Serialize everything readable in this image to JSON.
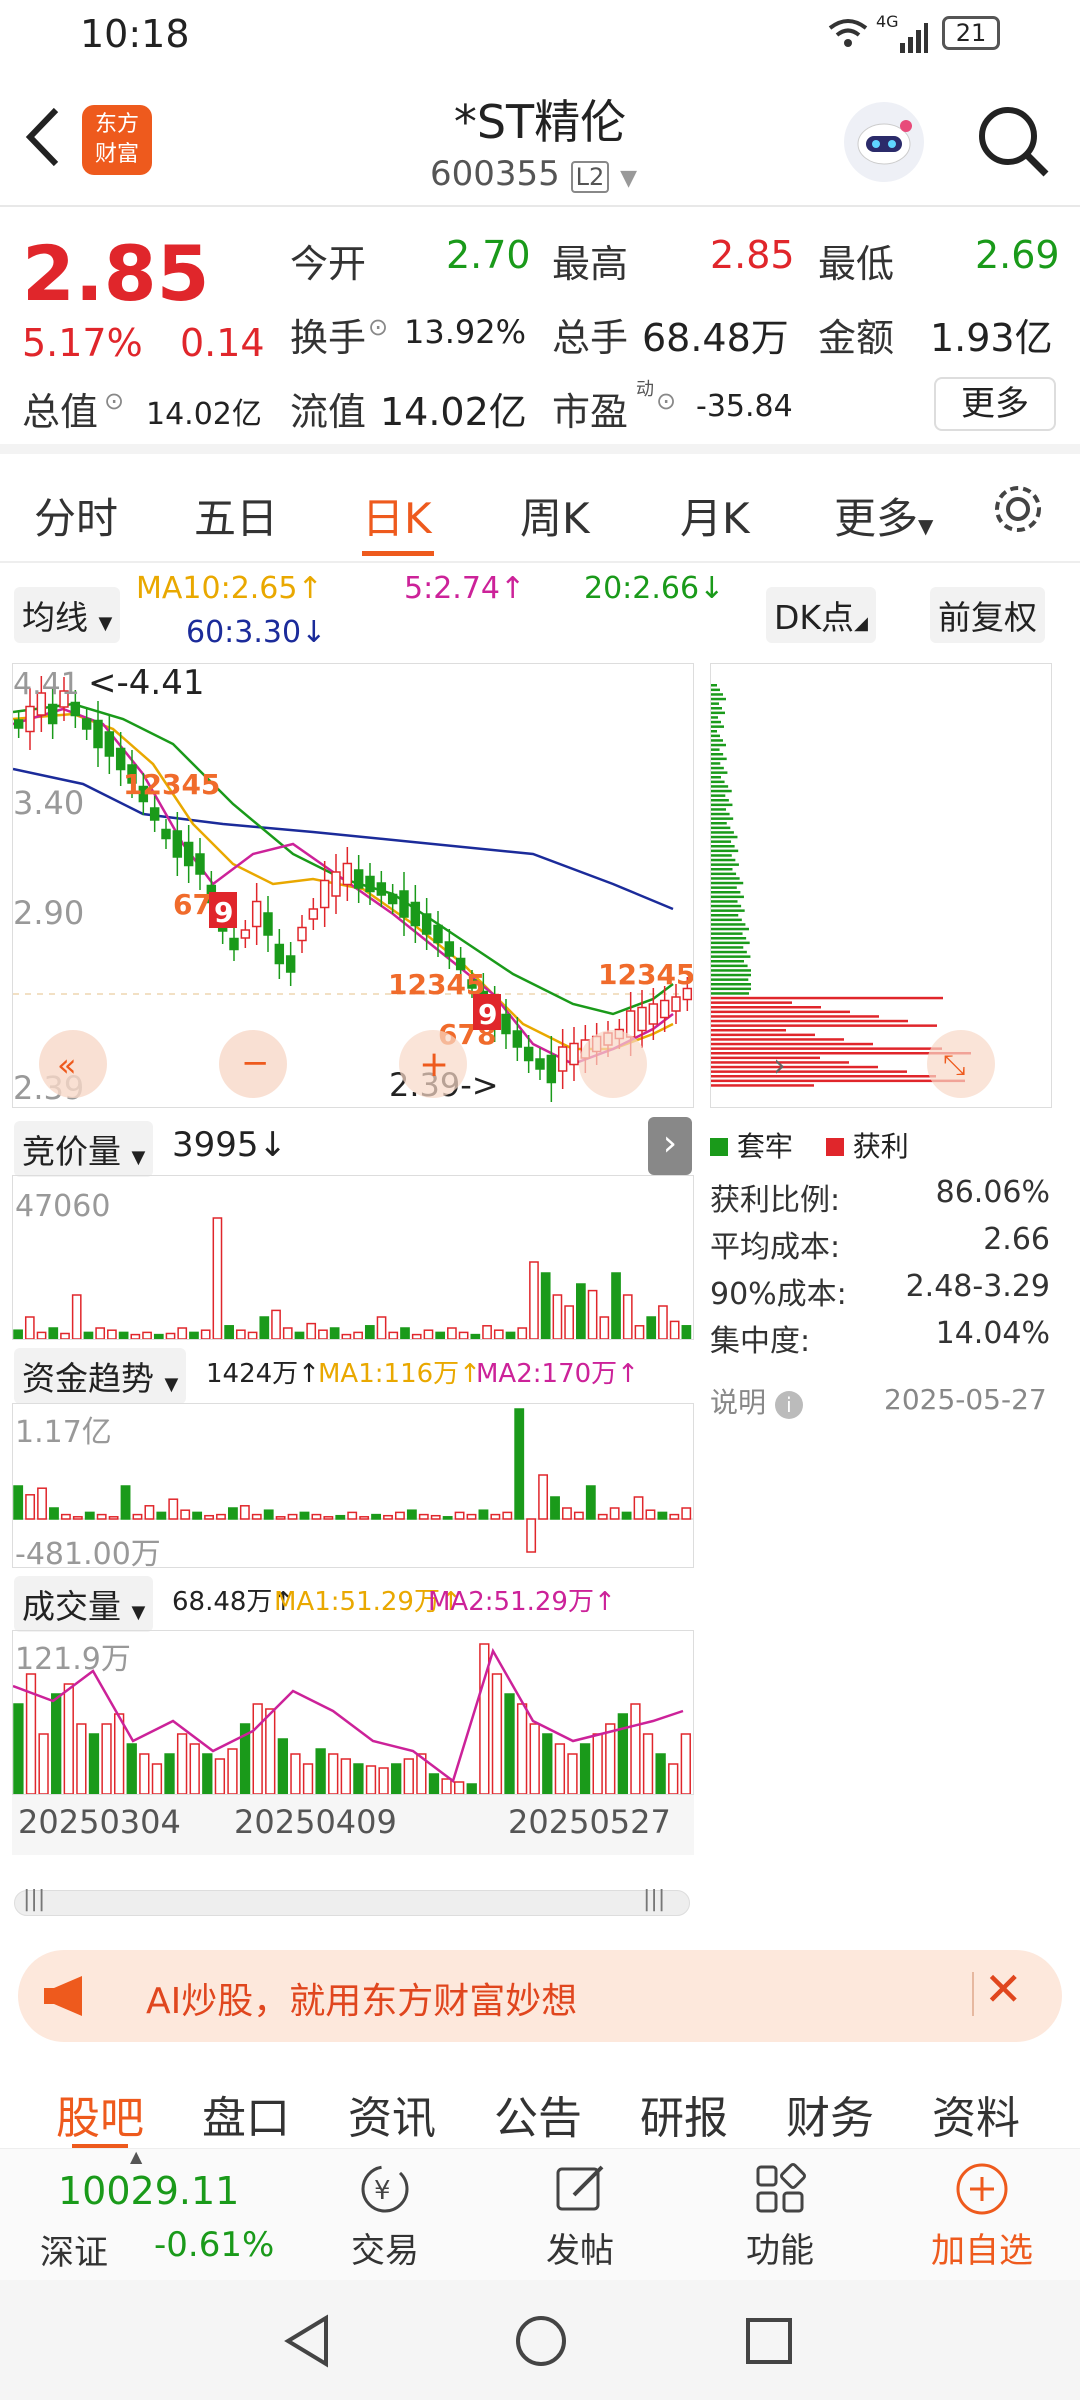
{
  "status": {
    "time": "10:18",
    "network": "4G",
    "battery": "21"
  },
  "header": {
    "title": "*ST精伦",
    "code": "600355",
    "level": "L2",
    "logo_line1": "东方",
    "logo_line2": "财富"
  },
  "quote": {
    "price": "2.85",
    "pct": "5.17%",
    "chg": "0.14",
    "open_label": "今开",
    "open": "2.70",
    "high_label": "最高",
    "high": "2.85",
    "low_label": "最低",
    "low": "2.69",
    "turnover_label": "换手",
    "turnover": "13.92%",
    "volume_label": "总手",
    "volume": "68.48万",
    "amount_label": "金额",
    "amount": "1.93亿",
    "mcap_label": "总值",
    "mcap": "14.02亿",
    "float_label": "流值",
    "float": "14.02亿",
    "pe_label": "市盈",
    "pe_sup": "动",
    "pe": "-35.84",
    "more": "更多"
  },
  "tabs": [
    "分时",
    "五日",
    "日K",
    "周K",
    "月K",
    "更多"
  ],
  "chart_labels": {
    "ma_select": "均线",
    "ma10": "MA10:2.65↑",
    "ma5": "5:2.74↑",
    "ma20": "20:2.66↓",
    "ma60": "60:3.30↓",
    "dk": "DK点",
    "fq": "前复权",
    "y1": "4.41",
    "y1_note": "<-4.41",
    "y2": "3.40",
    "y3": "2.90",
    "y4": "2.39",
    "low_note": "2.39->",
    "bid_select": "竞价量",
    "bid_val": "3995↓",
    "bid_max": "47060",
    "fund_select": "资金趋势",
    "fund_val": "1424万↑",
    "fund_ma1": "MA1:116万↑",
    "fund_ma2": "MA2:170万↑",
    "fund_max": "1.17亿",
    "fund_min": "-481.00万",
    "vol_select": "成交量",
    "vol_val": "68.48万↑",
    "vol_ma1": "MA1:51.29万↑",
    "vol_ma2": "MA2:51.29万↑",
    "vol_max": "121.9万",
    "date1": "20250304",
    "date2": "20250409",
    "date3": "20250527"
  },
  "chips": {
    "legend_trap": "套牢",
    "legend_profit": "获利",
    "rows": [
      {
        "label": "获利比例:",
        "value": "86.06%"
      },
      {
        "label": "平均成本:",
        "value": "2.66"
      },
      {
        "label": "90%成本:",
        "value": "2.48-3.29"
      },
      {
        "label": "集中度:",
        "value": "14.04%"
      }
    ],
    "note": "说明",
    "date": "2025-05-27"
  },
  "banner": {
    "text": "AI炒股，就用东方财富妙想"
  },
  "bottom_tabs": [
    "股吧",
    "盘口",
    "资讯",
    "公告",
    "研报",
    "财务",
    "资料"
  ],
  "dock": {
    "index_value": "10029.11",
    "index_name": "深证",
    "index_pct": "-0.61%",
    "trade": "交易",
    "post": "发帖",
    "func": "功能",
    "add": "加自选"
  },
  "colors": {
    "up": "#e0262b",
    "down": "#1a9a1a",
    "accent": "#ee5a1d"
  }
}
